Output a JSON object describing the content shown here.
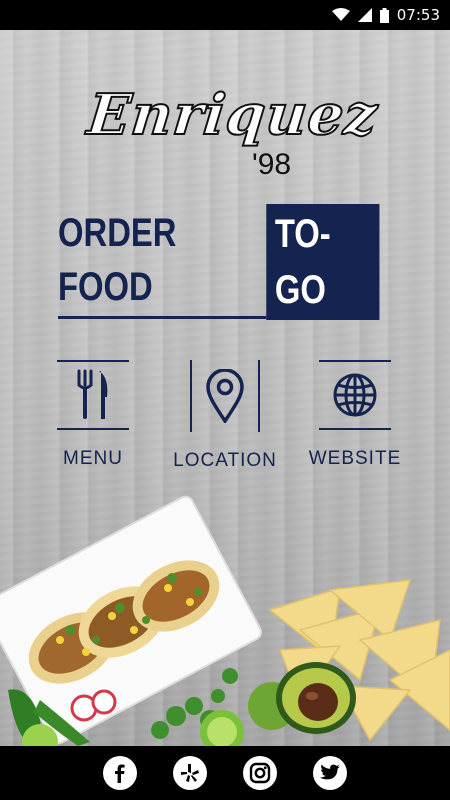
{
  "status_bar": {
    "time": "07:53"
  },
  "brand": {
    "name": "Enriquez",
    "year": "'98"
  },
  "headline": {
    "part1": "ORDER FOOD",
    "part2": "TO-GO"
  },
  "actions": [
    {
      "label": "MENU",
      "icon": "fork-knife-icon"
    },
    {
      "label": "LOCATION",
      "icon": "map-pin-icon"
    },
    {
      "label": "WEBSITE",
      "icon": "globe-icon"
    }
  ],
  "social": [
    {
      "icon": "facebook-icon"
    },
    {
      "icon": "yelp-icon"
    },
    {
      "icon": "instagram-icon"
    },
    {
      "icon": "twitter-icon"
    }
  ],
  "colors": {
    "navy": "#14234f",
    "wood": "#c4c4c4",
    "bar": "#000000"
  }
}
